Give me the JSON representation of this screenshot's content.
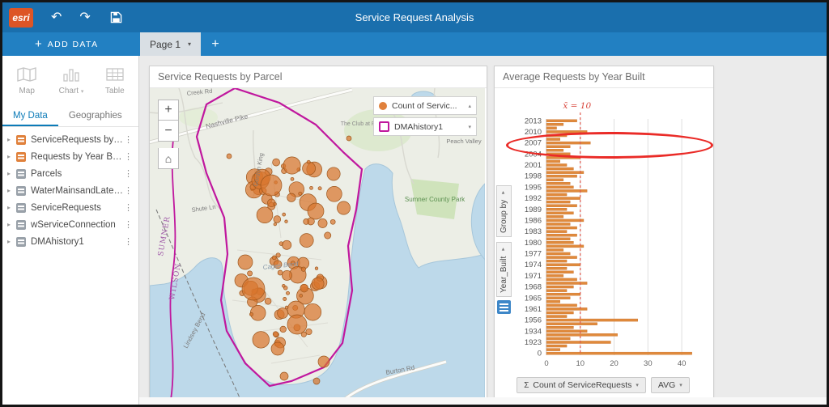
{
  "window": {
    "title": "Service Request Analysis"
  },
  "icons": {
    "undo": "↶",
    "redo": "↷",
    "plus": "+",
    "caret_down": "▾",
    "caret_up": "▴",
    "kebab": "⋮",
    "expand": "▸",
    "home": "⌂",
    "zoom_in": "+",
    "zoom_out": "−",
    "sigma": "Σ"
  },
  "toolbar": {
    "add_data_label": "ADD DATA",
    "page_tab_label": "Page 1"
  },
  "sidebar": {
    "tools": [
      {
        "label": "Map"
      },
      {
        "label": "Chart"
      },
      {
        "label": "Table"
      }
    ],
    "tabs": [
      {
        "label": "My Data"
      },
      {
        "label": "Geographies"
      }
    ],
    "datasets": [
      {
        "label": "ServiceRequests by Parcel",
        "type": "result"
      },
      {
        "label": "Requests by Year Built",
        "type": "result"
      },
      {
        "label": "Parcels",
        "type": "source"
      },
      {
        "label": "WaterMainsandLaterals",
        "type": "source"
      },
      {
        "label": "ServiceRequests",
        "type": "source"
      },
      {
        "label": "wServiceConnection",
        "type": "source"
      },
      {
        "label": "DMAhistory1",
        "type": "source"
      }
    ]
  },
  "map_card": {
    "title": "Service Requests by Parcel",
    "legend": [
      {
        "label": "Count of Servic..."
      },
      {
        "label": "DMAhistory1"
      }
    ],
    "labels": {
      "road1": "Nashville Pike",
      "road2": "Gordon King",
      "road3": "Shute Ln",
      "club": "The Club at Fairvue Plantation",
      "park": "Sumner County Park",
      "peach": "Peach Valley",
      "lindsey": "Lindsey Bend",
      "burton": "Burton Rd",
      "creekrd": "Creek Rd",
      "bend": "Cages Bend",
      "county1": "SUMNER",
      "county2": "WILSON"
    }
  },
  "chart_card": {
    "title": "Average Requests by Year Built",
    "group_by_label": "Group by",
    "field_label": "Year_Built",
    "stat_button": "Count of ServiceRequests",
    "agg_button": "AVG"
  },
  "chart_data": {
    "type": "bar",
    "orientation": "horizontal",
    "title": "Average Requests by Year Built",
    "x_ticks": [
      0,
      10,
      20,
      30,
      40
    ],
    "xlim": [
      0,
      45
    ],
    "mean": 10,
    "mean_label": "x̄ = 10",
    "rows": [
      {
        "label": "2013",
        "value": 9
      },
      {
        "label": "",
        "value": 5
      },
      {
        "label": "",
        "value": 3
      },
      {
        "label": "2010",
        "value": 12
      },
      {
        "label": "",
        "value": 6
      },
      {
        "label": "",
        "value": 4
      },
      {
        "label": "2007",
        "value": 13
      },
      {
        "label": "",
        "value": 7
      },
      {
        "label": "",
        "value": 5
      },
      {
        "label": "2004",
        "value": 7
      },
      {
        "label": "",
        "value": 10
      },
      {
        "label": "",
        "value": 4
      },
      {
        "label": "2001",
        "value": 6
      },
      {
        "label": "",
        "value": 8
      },
      {
        "label": "",
        "value": 11
      },
      {
        "label": "1998",
        "value": 9
      },
      {
        "label": "",
        "value": 5
      },
      {
        "label": "",
        "value": 7
      },
      {
        "label": "1995",
        "value": 8
      },
      {
        "label": "",
        "value": 12
      },
      {
        "label": "",
        "value": 6
      },
      {
        "label": "1992",
        "value": 10
      },
      {
        "label": "",
        "value": 7
      },
      {
        "label": "",
        "value": 9
      },
      {
        "label": "1989",
        "value": 6
      },
      {
        "label": "",
        "value": 8
      },
      {
        "label": "",
        "value": 5
      },
      {
        "label": "1986",
        "value": 11
      },
      {
        "label": "",
        "value": 7
      },
      {
        "label": "",
        "value": 9
      },
      {
        "label": "1983",
        "value": 6
      },
      {
        "label": "",
        "value": 9
      },
      {
        "label": "",
        "value": 7
      },
      {
        "label": "1980",
        "value": 8
      },
      {
        "label": "",
        "value": 11
      },
      {
        "label": "",
        "value": 5
      },
      {
        "label": "1977",
        "value": 7
      },
      {
        "label": "",
        "value": 9
      },
      {
        "label": "",
        "value": 6
      },
      {
        "label": "1974",
        "value": 10
      },
      {
        "label": "",
        "value": 6
      },
      {
        "label": "",
        "value": 8
      },
      {
        "label": "1971",
        "value": 5
      },
      {
        "label": "",
        "value": 9
      },
      {
        "label": "",
        "value": 12
      },
      {
        "label": "1968",
        "value": 8
      },
      {
        "label": "",
        "value": 6
      },
      {
        "label": "",
        "value": 10
      },
      {
        "label": "1965",
        "value": 7
      },
      {
        "label": "",
        "value": 4
      },
      {
        "label": "",
        "value": 9
      },
      {
        "label": "1961",
        "value": 12
      },
      {
        "label": "",
        "value": 8
      },
      {
        "label": "",
        "value": 6
      },
      {
        "label": "1956",
        "value": 27
      },
      {
        "label": "",
        "value": 15
      },
      {
        "label": "",
        "value": 8
      },
      {
        "label": "1934",
        "value": 12
      },
      {
        "label": "",
        "value": 21
      },
      {
        "label": "",
        "value": 7
      },
      {
        "label": "1923",
        "value": 19
      },
      {
        "label": "",
        "value": 6
      },
      {
        "label": "",
        "value": 4
      },
      {
        "label": "0",
        "value": 43
      }
    ]
  }
}
